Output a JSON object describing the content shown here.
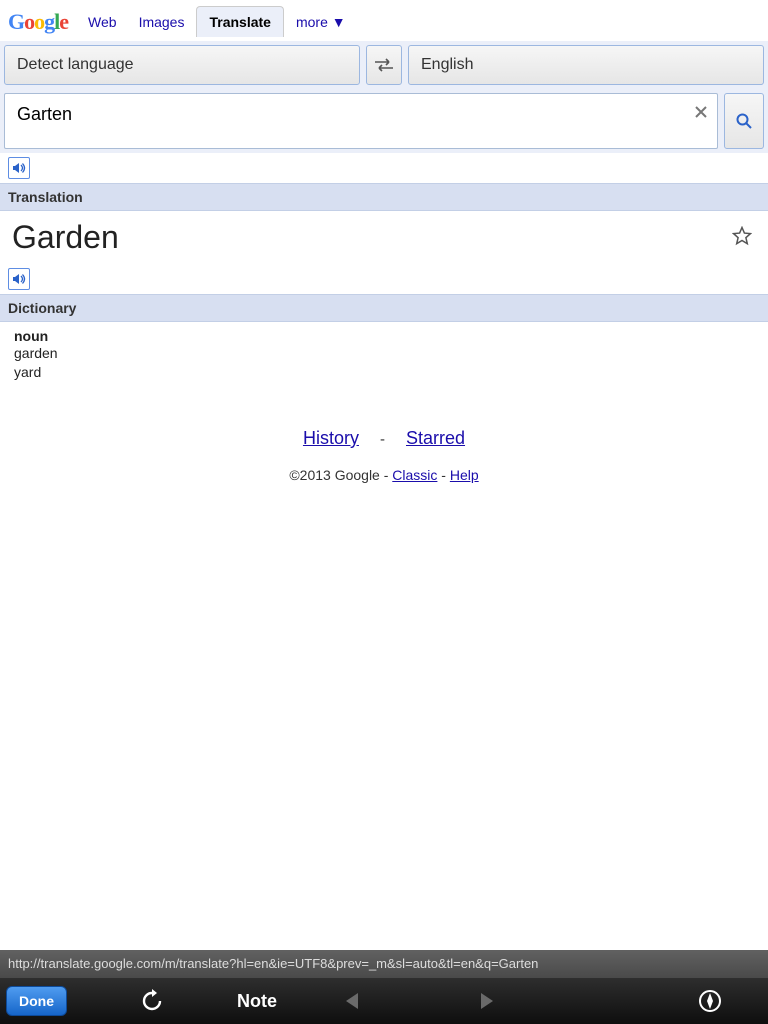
{
  "nav": {
    "web": "Web",
    "images": "Images",
    "translate": "Translate",
    "more": "more ▼"
  },
  "langs": {
    "source": "Detect language",
    "target": "English"
  },
  "input": {
    "value": "Garten"
  },
  "sections": {
    "translation": "Translation",
    "dictionary": "Dictionary"
  },
  "translation": {
    "text": "Garden"
  },
  "dictionary": {
    "pos": "noun",
    "defs": [
      "garden",
      "yard"
    ]
  },
  "footer": {
    "history": "History",
    "starred": "Starred",
    "copyright": "©2013 Google - ",
    "classic": "Classic",
    "sep": " - ",
    "help": "Help"
  },
  "urlbar": "http://translate.google.com/m/translate?hl=en&ie=UTF8&prev=_m&sl=auto&tl=en&q=Garten",
  "toolbar": {
    "done": "Done",
    "note": "Note"
  }
}
